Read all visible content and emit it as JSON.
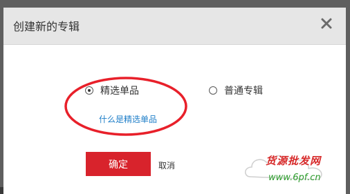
{
  "dialog": {
    "title": "创建新的专辑",
    "close_icon": "close-icon"
  },
  "options": [
    {
      "label": "精选单品",
      "checked": true
    },
    {
      "label": "普通专辑",
      "checked": false
    }
  ],
  "help_link": "什么是精选单品",
  "buttons": {
    "confirm": "确定",
    "cancel": "取消"
  },
  "watermark": {
    "line1": "货源批发网",
    "line2": "www.6pf.cn"
  },
  "colors": {
    "accent": "#d8232c",
    "link": "#1e7ec8",
    "annotation": "#e8202a"
  }
}
